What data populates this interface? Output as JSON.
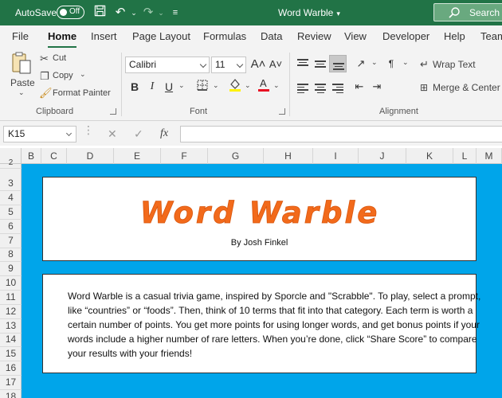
{
  "titlebar": {
    "autosave_label": "AutoSave",
    "autosave_state": "Off",
    "doc_title": "Word Warble",
    "search_placeholder": "Search (A"
  },
  "tabs": [
    "File",
    "Home",
    "Insert",
    "Page Layout",
    "Formulas",
    "Data",
    "Review",
    "View",
    "Developer",
    "Help",
    "Team"
  ],
  "active_tab": "Home",
  "clipboard": {
    "paste_label": "Paste",
    "cut_label": "Cut",
    "copy_label": "Copy",
    "format_painter_label": "Format Painter",
    "group_label": "Clipboard"
  },
  "font": {
    "font_name": "Calibri",
    "font_size": "11",
    "group_label": "Font",
    "font_color": "#e81123",
    "highlight_color": "#fff200"
  },
  "alignment": {
    "wrap_text_label": "Wrap Text",
    "merge_center_label": "Merge & Center",
    "group_label": "Alignment"
  },
  "formula_bar": {
    "name_box": "K15",
    "fx_label": "fx",
    "formula": ""
  },
  "columns": [
    "B",
    "C",
    "D",
    "E",
    "F",
    "G",
    "H",
    "I",
    "J",
    "K",
    "L",
    "M"
  ],
  "rows": [
    "2",
    "3",
    "4",
    "5",
    "6",
    "7",
    "8",
    "9",
    "10",
    "11",
    "12",
    "13",
    "14",
    "15",
    "16",
    "17",
    "18"
  ],
  "sheet": {
    "background_color": "#00a5ea",
    "title": "Word Warble",
    "title_color": "#f26a1b",
    "byline": "By Josh Finkel",
    "description": "Word Warble is a casual trivia game, inspired by Sporcle and \"Scrabble\". To play, select a prompt, like “countries” or “foods”. Then, think of 10 terms that fit into that category. Each term is worth a certain number of points. You get more points for using longer words, and get bonus points if your words include a higher number of rare letters. When you’re done, click “Share Score” to compare your results with your friends!"
  }
}
